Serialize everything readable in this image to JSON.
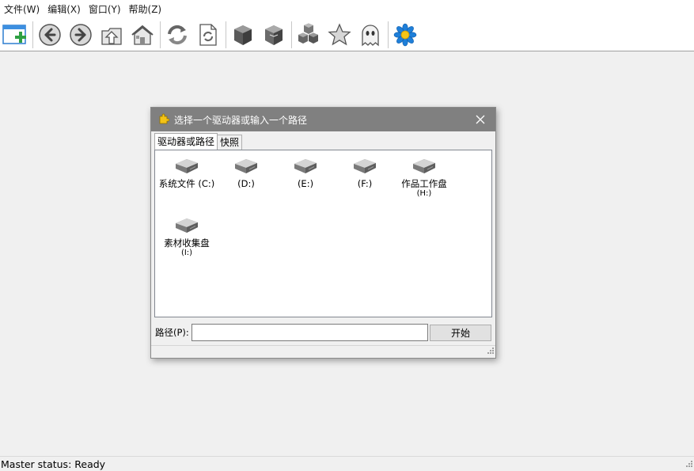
{
  "menu": {
    "items": [
      "文件(W)",
      "编辑(X)",
      "窗口(Y)",
      "帮助(Z)"
    ]
  },
  "toolbar": {
    "buttons": [
      {
        "icon": "new-window-icon"
      },
      {
        "icon": "back-arrow-icon"
      },
      {
        "icon": "forward-arrow-icon"
      },
      {
        "icon": "up-folder-icon"
      },
      {
        "icon": "home-icon"
      },
      {
        "icon": "refresh-icon"
      },
      {
        "icon": "refresh-document-icon"
      },
      {
        "icon": "cube-icon"
      },
      {
        "icon": "cube-alt-icon"
      },
      {
        "icon": "cubes-icon"
      },
      {
        "icon": "star-icon"
      },
      {
        "icon": "ghost-icon"
      },
      {
        "icon": "flower-icon"
      }
    ]
  },
  "dialog": {
    "title": "选择一个驱动器或输入一个路径",
    "tabs": [
      "驱动器或路径",
      "快照"
    ],
    "drives": [
      {
        "label": "系统文件 (C:)",
        "sub": ""
      },
      {
        "label": "(D:)",
        "sub": ""
      },
      {
        "label": "(E:)",
        "sub": ""
      },
      {
        "label": "(F:)",
        "sub": ""
      },
      {
        "label": "作品工作盘",
        "sub": "(H:)"
      },
      {
        "label": "素材收集盘",
        "sub": "(I:)"
      }
    ],
    "path_label": "路径(P):",
    "path_value": "",
    "start_label": "开始"
  },
  "status": {
    "text": "Master status: Ready"
  },
  "colors": {
    "title_bar": "#808080",
    "accent_blue": "#1e7fd9"
  }
}
